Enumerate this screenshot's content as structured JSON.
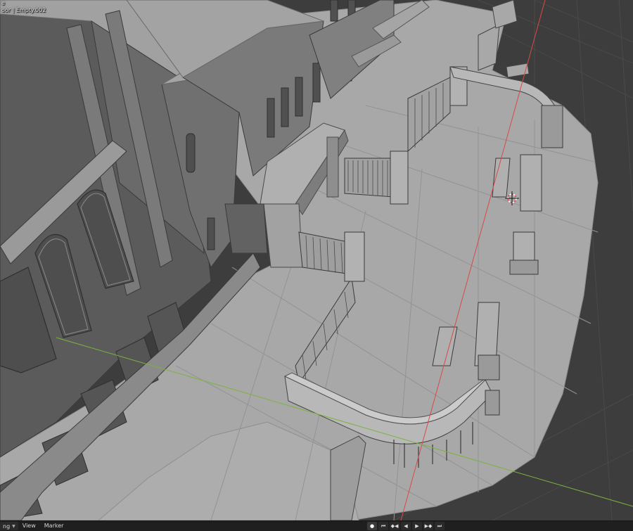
{
  "viewport": {
    "mode_text": "e",
    "collection_text": "oor | Empty.002",
    "colors": {
      "background": "#3d3d3d",
      "x_axis": "#d84a4a",
      "y_axis": "#7bb33e",
      "model_light": "#a7a7a7",
      "model_dark": "#5a5a5a"
    }
  },
  "timeline": {
    "playback_label": "ng",
    "menus": [
      "View",
      "Marker"
    ],
    "transport": {
      "record": "●",
      "jump_start": "⏮",
      "prev_keyframe": "◆◀",
      "play_reverse": "◀",
      "play": "▶",
      "next_keyframe": "▶◆",
      "jump_end": "⏭"
    }
  }
}
